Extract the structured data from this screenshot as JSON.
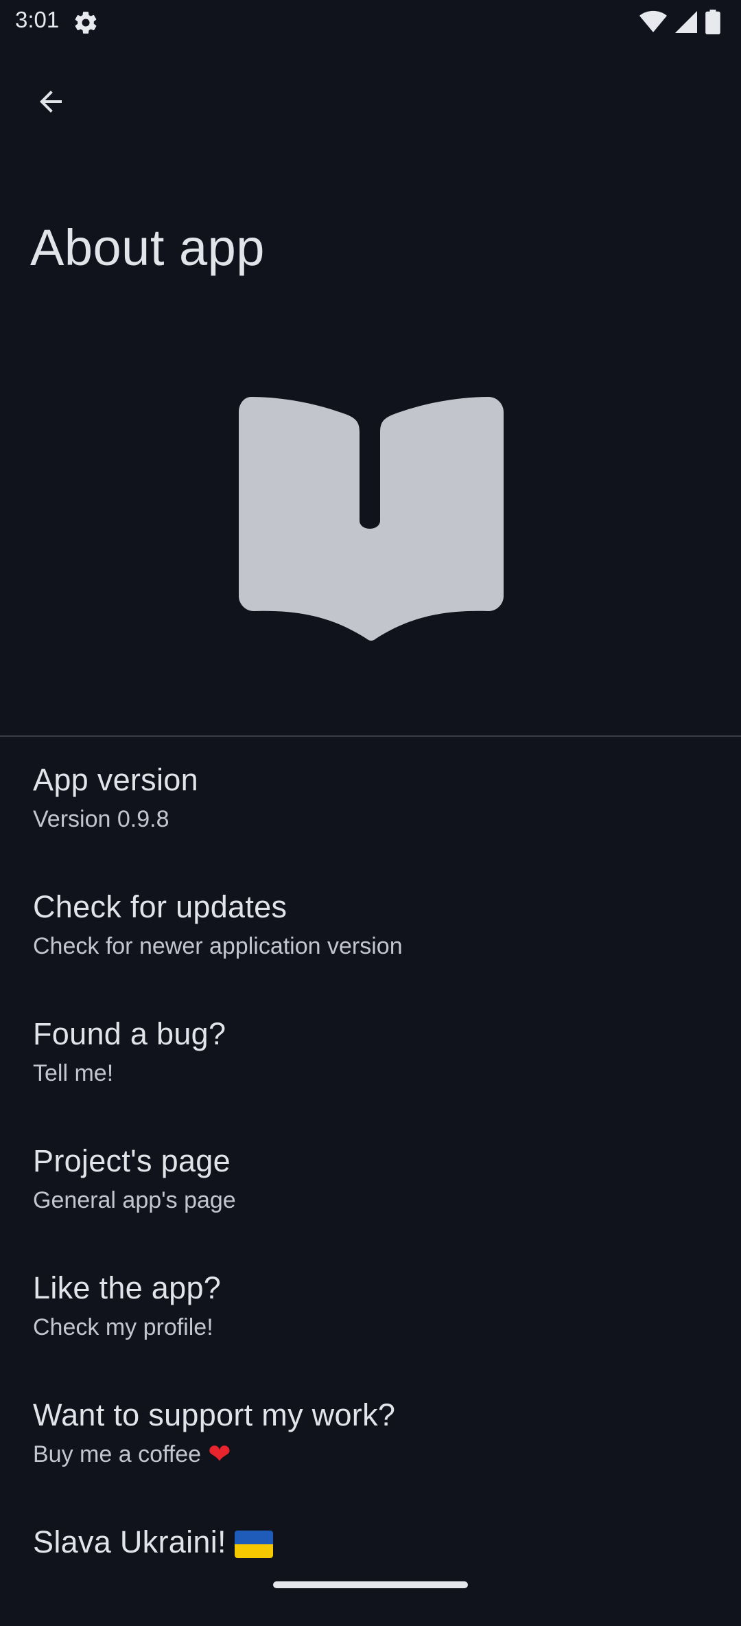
{
  "status_bar": {
    "time": "3:01",
    "icons": [
      "gear-icon",
      "wifi-icon",
      "signal-icon",
      "battery-icon"
    ]
  },
  "app_bar": {
    "back_icon": "arrow-back-icon"
  },
  "title": "About app",
  "logo": {
    "icon": "open-book-icon",
    "color": "#c3c5cd"
  },
  "items": [
    {
      "title": "App version",
      "summary": "Version 0.9.8"
    },
    {
      "title": "Check for updates",
      "summary": "Check for newer application version"
    },
    {
      "title": "Found a bug?",
      "summary": "Tell me!"
    },
    {
      "title": "Project's page",
      "summary": "General app's page"
    },
    {
      "title": "Like the app?",
      "summary": "Check my profile!"
    },
    {
      "title": "Want to support my work?",
      "summary": "Buy me a coffee",
      "summary_suffix": "❤"
    },
    {
      "title": "Slava Ukraini!",
      "title_suffix_icon": "ukraine-flag-icon"
    }
  ],
  "colors": {
    "background": "#10131c",
    "text_primary": "#e3e4ea",
    "text_secondary": "#c4c6cf",
    "heart": "#e8242d",
    "flag_blue": "#1f5bb8",
    "flag_yellow": "#f5c800"
  }
}
